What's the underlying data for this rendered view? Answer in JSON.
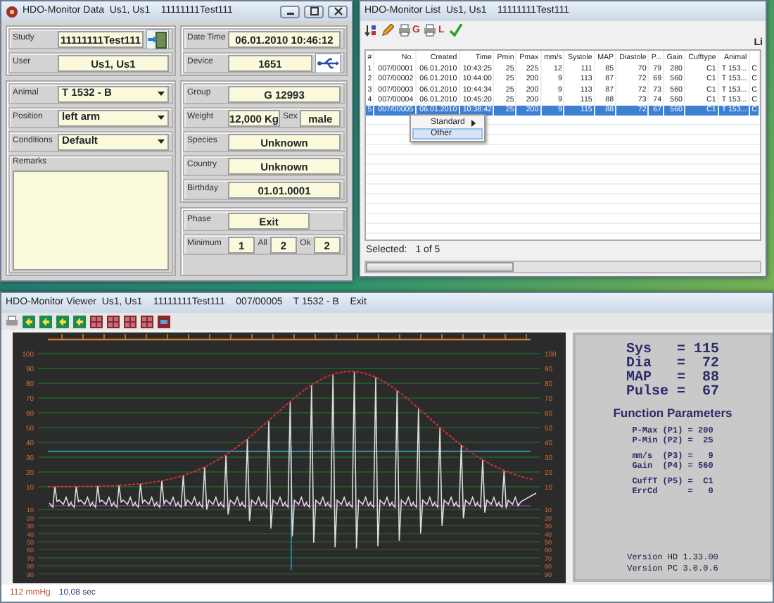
{
  "data_window": {
    "title": "HDO-Monitor Data  Us1, Us1    11111111Test111",
    "left_groups": [
      [
        {
          "kind": "door",
          "label": "Study",
          "value": "11111111Test111"
        },
        {
          "kind": "field",
          "label": "User",
          "value": "Us1, Us1"
        }
      ],
      [
        {
          "kind": "select",
          "label": "Animal",
          "value": "T 1532 - B"
        },
        {
          "kind": "select",
          "label": "Position",
          "value": "left arm"
        },
        {
          "kind": "select",
          "label": "Conditions",
          "value": "Default"
        },
        {
          "kind": "remarks",
          "label": "Remarks"
        }
      ]
    ],
    "right_groups": [
      [
        {
          "kind": "field",
          "label": "Date Time",
          "value": "06.01.2010 10:46:12"
        },
        {
          "kind": "usb",
          "label": "Device",
          "value": "1651"
        }
      ],
      [
        {
          "kind": "field",
          "label": "Group",
          "value": "G 12993"
        },
        {
          "kind": "multi",
          "parts": [
            {
              "label": "Weight",
              "value": "12,000 Kg"
            },
            {
              "label": "Sex",
              "value": "male"
            }
          ]
        },
        {
          "kind": "field",
          "label": "Species",
          "value": "Unknown"
        },
        {
          "kind": "field",
          "label": "Country",
          "value": "Unknown"
        },
        {
          "kind": "field",
          "label": "Birthday",
          "value": "01.01.0001"
        }
      ],
      [
        {
          "kind": "short",
          "label": "Phase",
          "value": "Exit"
        },
        {
          "kind": "multi",
          "parts": [
            {
              "label": "Minimum",
              "value": "1"
            },
            {
              "label": "All",
              "value": "2"
            },
            {
              "label": "Ok",
              "value": "2"
            }
          ]
        }
      ]
    ]
  },
  "list_window": {
    "title": "HDO-Monitor List  Us1, Us1    11111111Test111",
    "toolbar": [
      {
        "kind": "sort"
      },
      {
        "kind": "edit"
      },
      {
        "kind": "print",
        "label": "G"
      },
      {
        "kind": "print",
        "label": "L"
      },
      {
        "kind": "check"
      }
    ],
    "corner_label": "Li",
    "columns": [
      "#",
      "No.",
      "Created",
      "Time",
      "Pmin",
      "Pmax",
      "mm/s",
      "Systole",
      "MAP",
      "Diastole",
      "P...",
      "Gain",
      "Cufftype",
      "Animal"
    ],
    "rows": [
      {
        "cells": [
          "1",
          "007/00001",
          "06.01.2010",
          "10:43:25",
          "25",
          "225",
          "12",
          "111",
          "85",
          "70",
          "79",
          "280",
          "C1",
          "T 153...",
          "C"
        ],
        "selected": false
      },
      {
        "cells": [
          "2",
          "007/00002",
          "06.01.2010",
          "10:44:00",
          "25",
          "200",
          "9",
          "113",
          "87",
          "72",
          "69",
          "560",
          "C1",
          "T 153...",
          "C"
        ],
        "selected": false
      },
      {
        "cells": [
          "3",
          "007/00003",
          "06.01.2010",
          "10:44:34",
          "25",
          "200",
          "9",
          "113",
          "87",
          "72",
          "73",
          "560",
          "C1",
          "T 153...",
          "C"
        ],
        "selected": false
      },
      {
        "cells": [
          "4",
          "007/00004",
          "06.01.2010",
          "10:45:20",
          "25",
          "200",
          "9",
          "115",
          "88",
          "73",
          "74",
          "560",
          "C1",
          "T 153...",
          "C"
        ],
        "selected": false
      },
      {
        "cells": [
          "5",
          "007/00005",
          "06.01.2010",
          "10:38:42",
          "25",
          "200",
          "9",
          "115",
          "88",
          "72",
          "67",
          "560",
          "C1",
          "T 153...",
          "C"
        ],
        "selected": true
      }
    ],
    "context_menu": [
      {
        "label": "Standard",
        "submenu": true,
        "selected": false
      },
      {
        "label": "Other",
        "submenu": false,
        "selected": true
      }
    ],
    "status_label": "Selected:",
    "status_value": "1 of 5"
  },
  "viewer_window": {
    "title": "HDO-Monitor Viewer  Us1, Us1    11111111Test111    007/00005    T 1532 - B    Exit",
    "toolbar": [
      {
        "kind": "print"
      },
      {
        "kind": "nav"
      },
      {
        "kind": "nav"
      },
      {
        "kind": "nav"
      },
      {
        "kind": "nav"
      },
      {
        "kind": "zoom"
      },
      {
        "kind": "zoom"
      },
      {
        "kind": "zoom"
      },
      {
        "kind": "zoom"
      },
      {
        "kind": "view"
      }
    ],
    "chart": {
      "left_axis": {
        "upper": [
          "100",
          "90",
          "80",
          "70",
          "60",
          "50",
          "40",
          "30",
          "20",
          "10"
        ],
        "lower": [
          "10",
          "20",
          "30",
          "40",
          "50",
          "60",
          "70",
          "80",
          "90"
        ]
      },
      "right_axis": {
        "upper": [
          "100",
          "90",
          "80",
          "70",
          "60",
          "50",
          "40",
          "30",
          "20",
          "10"
        ],
        "lower": [
          "10",
          "20",
          "30",
          "40",
          "50",
          "60",
          "70",
          "80",
          "90"
        ]
      }
    },
    "readings": [
      "Sys   = 115",
      "Dia   =  72",
      "MAP   =  88",
      "Pulse =  67"
    ],
    "parameters_title": "Function Parameters",
    "parameter_groups": [
      [
        "P-Max (P1) = 200",
        "P-Min (P2) =  25"
      ],
      [
        "mm/s  (P3) =   9",
        "Gain  (P4) = 560"
      ],
      [
        "CuffT (P5) =  C1",
        "ErrCd      =   0"
      ]
    ],
    "versions": [
      "Version HD 1.33.00",
      "Version PC 3.0.0.6"
    ],
    "status_pressure": "112 mmHg",
    "status_time": "10,08 sec"
  }
}
